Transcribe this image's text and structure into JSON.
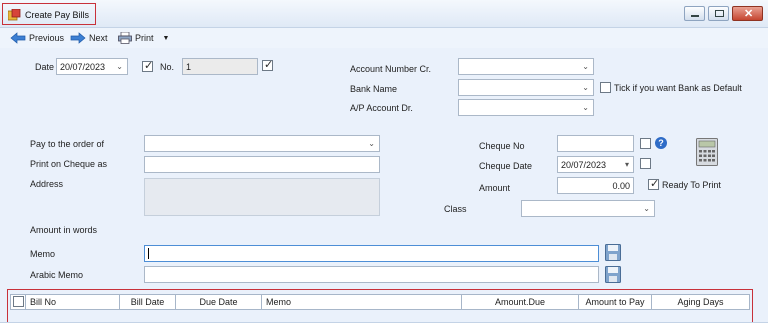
{
  "window": {
    "title": "Create Pay Bills"
  },
  "toolbar": {
    "previous": "Previous",
    "next": "Next",
    "print": "Print"
  },
  "form": {
    "date_label": "Date",
    "date_value": "20/07/2023",
    "no_label": "No.",
    "no_value": "1",
    "account_number_label": "Account Number Cr.",
    "bank_name_label": "Bank Name",
    "bank_default_label": "Tick if you want Bank as Default",
    "ap_account_label": "A/P Account Dr.",
    "pay_to_label": "Pay to the order of",
    "print_cheque_label": "Print on Cheque as",
    "address_label": "Address",
    "cheque_no_label": "Cheque No",
    "cheque_date_label": "Cheque Date",
    "cheque_date_value": "20/07/2023",
    "amount_label": "Amount",
    "amount_value": "0.00",
    "ready_to_print_label": "Ready To Print",
    "class_label": "Class",
    "amount_words_label": "Amount in words",
    "memo_label": "Memo",
    "arabic_memo_label": "Arabic Memo"
  },
  "grid": {
    "columns": [
      "Bill No",
      "Bill Date",
      "Due Date",
      "Memo",
      "Amount.Due",
      "Amount to Pay",
      "Aging Days"
    ]
  },
  "colors": {
    "highlight": "#c8313a",
    "background": "#eaf1fb"
  }
}
